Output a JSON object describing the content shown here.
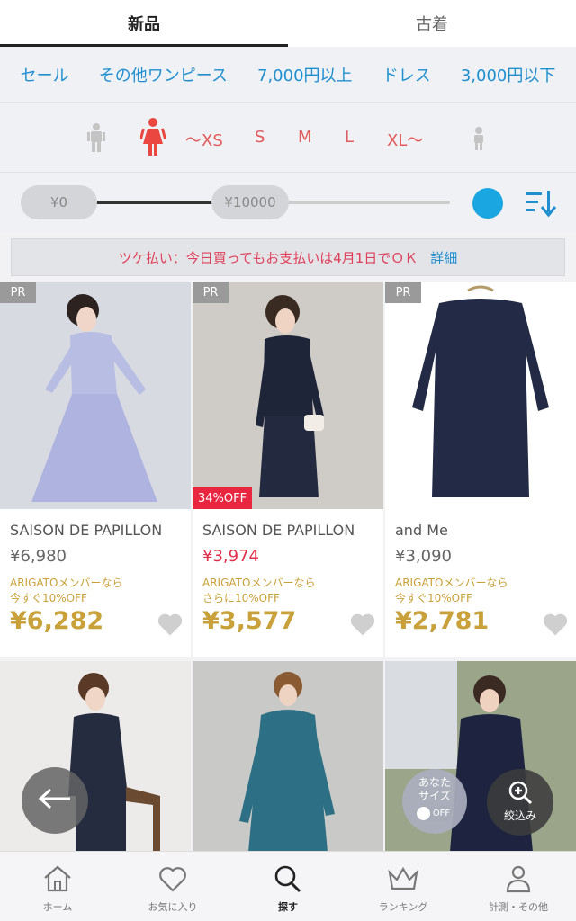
{
  "tabs": [
    {
      "label": "新品",
      "active": true
    },
    {
      "label": "古着",
      "active": false
    }
  ],
  "categories": [
    "セール",
    "その他ワンピース",
    "7,000円以上",
    "ドレス",
    "3,000円以下"
  ],
  "size_filter": {
    "male_icon": "male-person-icon",
    "female_icon": "female-person-icon",
    "kids_icon": "kids-person-icon",
    "sizes": [
      "～XS",
      "S",
      "M",
      "L",
      "XL～"
    ]
  },
  "price_filter": {
    "min_label": "¥0",
    "max_label": "¥10000",
    "selected_fraction": 0.4
  },
  "banner": {
    "message": "ツケ払い：今日買ってもお支払いは4月1日でＯＫ",
    "link": "詳細"
  },
  "products": [
    {
      "pr": "PR",
      "brand": "SAISON DE PAPILLON",
      "original_price": "¥6,980",
      "promo_line1": "ARIGATOメンバーなら",
      "promo_line2": "今すぐ10%OFF",
      "final_price": "¥6,282",
      "discount_badge": ""
    },
    {
      "pr": "PR",
      "brand": "SAISON DE PAPILLON",
      "original_price": "¥3,974",
      "promo_line1": "ARIGATOメンバーなら",
      "promo_line2": "さらに10%OFF",
      "final_price": "¥3,577",
      "discount_badge": "34%OFF"
    },
    {
      "pr": "PR",
      "brand": "and Me",
      "original_price": "¥3,090",
      "promo_line1": "ARIGATOメンバーなら",
      "promo_line2": "今すぐ10%OFF",
      "final_price": "¥2,781",
      "discount_badge": ""
    }
  ],
  "floating": {
    "your_size_line1": "あなた",
    "your_size_line2": "サイズ",
    "toggle_label": "OFF",
    "filter_label": "絞込み"
  },
  "bottom_nav": [
    {
      "label": "ホーム",
      "icon": "home-icon",
      "active": false
    },
    {
      "label": "お気に入り",
      "icon": "heart-icon",
      "active": false
    },
    {
      "label": "探す",
      "icon": "search-icon",
      "active": true
    },
    {
      "label": "ランキング",
      "icon": "crown-icon",
      "active": false
    },
    {
      "label": "計測・その他",
      "icon": "person-icon",
      "active": false
    }
  ],
  "colors": {
    "accent_blue": "#1f8fd0",
    "size_red": "#e25a5a",
    "gold": "#c9a13a",
    "sale_red": "#e0304a"
  }
}
